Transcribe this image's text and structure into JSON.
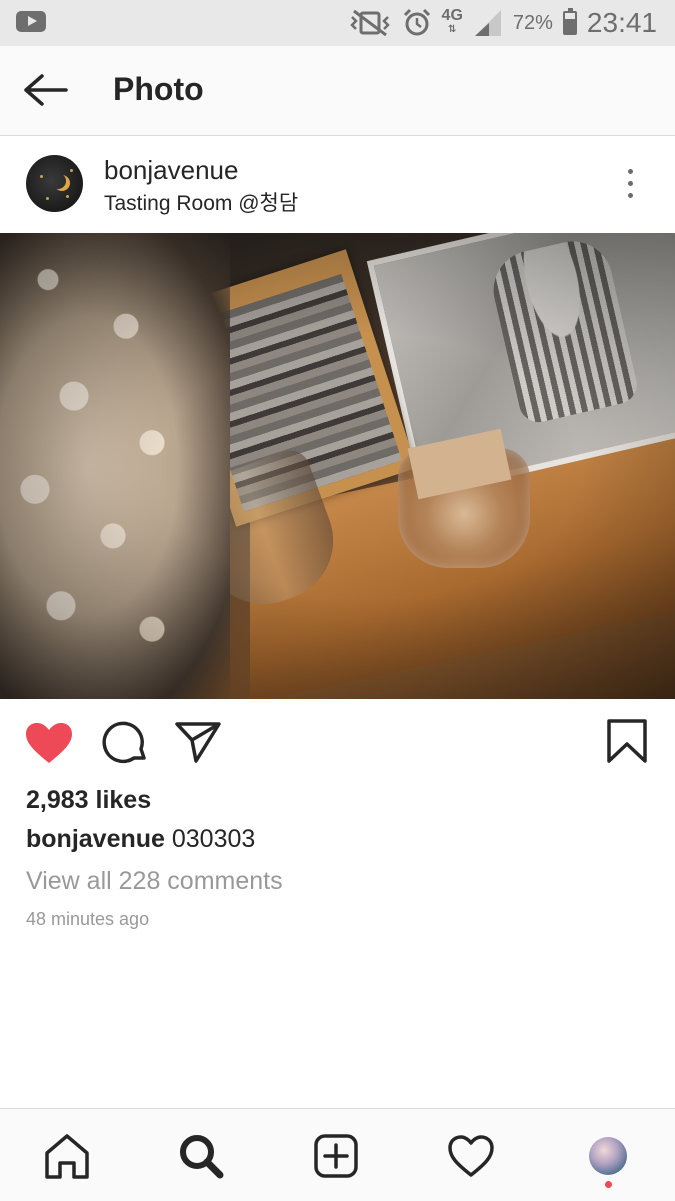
{
  "status_bar": {
    "network": "4G",
    "battery_percent": "72%",
    "battery_level": 0.72,
    "time": "23:41",
    "icons": [
      "youtube-icon",
      "vibrate-mute-icon",
      "alarm-icon",
      "signal-icon",
      "battery-icon"
    ]
  },
  "header": {
    "title": "Photo",
    "back_icon": "arrow-left-icon"
  },
  "post": {
    "username": "bonjavenue",
    "location": "Tasting Room @청담",
    "photo_description_icon": "post-photo",
    "liked": true,
    "likes": "2,983 likes",
    "caption_user": "bonjavenue",
    "caption_text": " 030303",
    "comments_link": "View all 228 comments",
    "time_ago": "48 minutes ago"
  },
  "actions": {
    "icons": [
      "heart-filled-icon",
      "comment-icon",
      "send-icon",
      "bookmark-icon"
    ]
  },
  "bottom_nav": {
    "items": [
      "home-icon",
      "search-icon",
      "add-post-icon",
      "heart-icon",
      "profile-avatar"
    ],
    "notification_dot": true
  },
  "colors": {
    "like_red": "#ed4956",
    "text": "#262626",
    "muted": "#999999",
    "bar_bg": "#fafafa",
    "status_bg": "#e8e8e8"
  }
}
